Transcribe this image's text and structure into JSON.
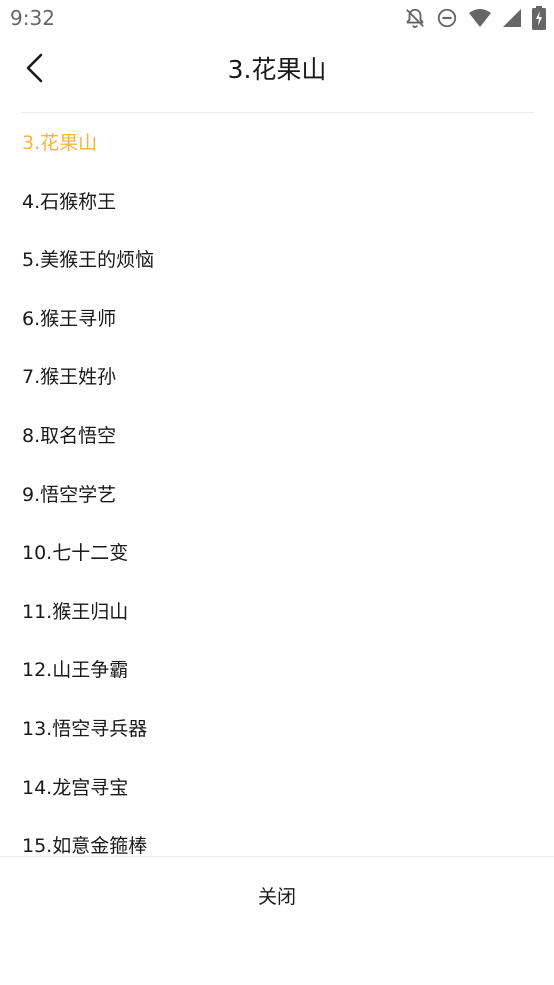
{
  "status_bar": {
    "time": "9:32",
    "icons": [
      "notifications-off-icon",
      "do-not-disturb-icon",
      "wifi-icon",
      "cell-signal-icon",
      "battery-charging-icon"
    ]
  },
  "header": {
    "back_icon": "chevron-left-icon",
    "title": "3.花果山"
  },
  "chapters": {
    "active_color": "#f5b342",
    "items": [
      {
        "label": "3.花果山",
        "active": true
      },
      {
        "label": "4.石猴称王",
        "active": false
      },
      {
        "label": "5.美猴王的烦恼",
        "active": false
      },
      {
        "label": "6.猴王寻师",
        "active": false
      },
      {
        "label": "7.猴王姓孙",
        "active": false
      },
      {
        "label": "8.取名悟空",
        "active": false
      },
      {
        "label": "9.悟空学艺",
        "active": false
      },
      {
        "label": "10.七十二变",
        "active": false
      },
      {
        "label": "11.猴王归山",
        "active": false
      },
      {
        "label": "12.山王争霸",
        "active": false
      },
      {
        "label": "13.悟空寻兵器",
        "active": false
      },
      {
        "label": "14.龙宫寻宝",
        "active": false
      },
      {
        "label": "15.如意金箍棒",
        "active": false
      }
    ]
  },
  "footer": {
    "close_label": "关闭"
  }
}
